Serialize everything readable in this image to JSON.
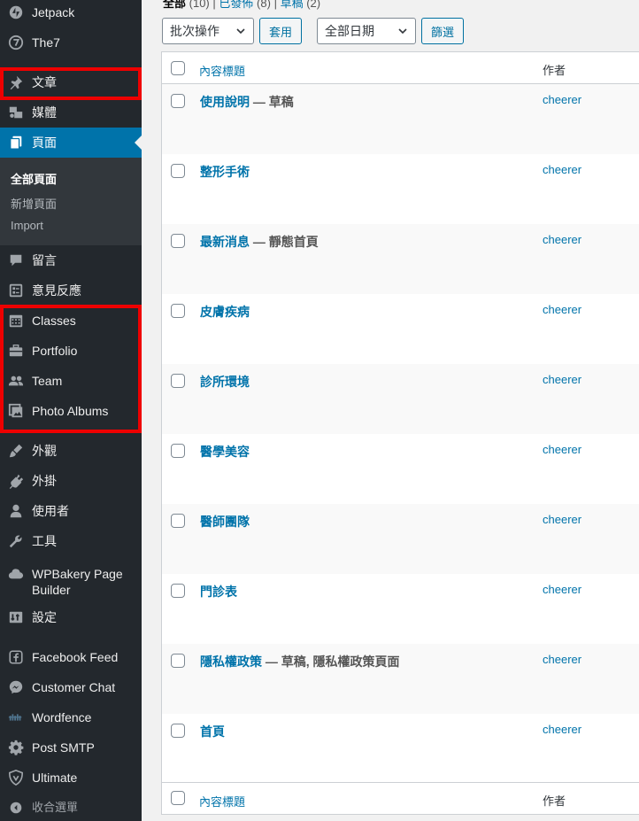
{
  "sidebar": {
    "items": [
      {
        "key": "jetpack",
        "label": "Jetpack",
        "icon": "jetpack-icon"
      },
      {
        "key": "the7",
        "label": "The7",
        "icon": "the7-icon"
      },
      {
        "key": "posts",
        "label": "文章",
        "icon": "pin-icon"
      },
      {
        "key": "media",
        "label": "媒體",
        "icon": "media-icon"
      },
      {
        "key": "pages",
        "label": "頁面",
        "icon": "pages-icon"
      },
      {
        "key": "comments",
        "label": "留言",
        "icon": "comment-icon"
      },
      {
        "key": "feedback",
        "label": "意見反應",
        "icon": "feedback-icon"
      },
      {
        "key": "classes",
        "label": "Classes",
        "icon": "calendar-icon"
      },
      {
        "key": "portfolio",
        "label": "Portfolio",
        "icon": "briefcase-icon"
      },
      {
        "key": "team",
        "label": "Team",
        "icon": "team-icon"
      },
      {
        "key": "albums",
        "label": "Photo Albums",
        "icon": "gallery-icon"
      },
      {
        "key": "appearance",
        "label": "外觀",
        "icon": "brush-icon"
      },
      {
        "key": "plugins",
        "label": "外掛",
        "icon": "plugin-icon"
      },
      {
        "key": "users",
        "label": "使用者",
        "icon": "user-icon"
      },
      {
        "key": "tools",
        "label": "工具",
        "icon": "wrench-icon"
      },
      {
        "key": "wpbakery",
        "label": "WPBakery Page Builder",
        "icon": "cloud-icon"
      },
      {
        "key": "settings",
        "label": "設定",
        "icon": "settings-icon"
      },
      {
        "key": "facebook",
        "label": "Facebook Feed",
        "icon": "facebook-icon"
      },
      {
        "key": "chat",
        "label": "Customer Chat",
        "icon": "messenger-icon"
      },
      {
        "key": "wordfence",
        "label": "Wordfence",
        "icon": "wordfence-icon"
      },
      {
        "key": "smtp",
        "label": "Post SMTP",
        "icon": "gear-icon"
      },
      {
        "key": "ultimate",
        "label": "Ultimate",
        "icon": "shield-icon"
      },
      {
        "key": "collapse",
        "label": "收合選單",
        "icon": "collapse-icon"
      }
    ],
    "submenu": [
      "全部頁面",
      "新增頁面",
      "Import"
    ]
  },
  "views": {
    "all": "全部",
    "all_count": "(10)",
    "published": "已發佈",
    "published_count": "(8)",
    "drafts": "草稿",
    "drafts_count": "(2)",
    "sep": "|"
  },
  "toolbar": {
    "bulk_action": "批次操作",
    "apply": "套用",
    "date_filter": "全部日期",
    "filter": "篩選"
  },
  "table": {
    "col_title": "內容標題",
    "col_author": "作者",
    "rows": [
      {
        "title": "使用說明",
        "state": " — 草稿",
        "author": "cheerer"
      },
      {
        "title": "整形手術",
        "state": "",
        "author": "cheerer"
      },
      {
        "title": "最新消息",
        "state": " — 靜態首頁",
        "author": "cheerer"
      },
      {
        "title": "皮膚疾病",
        "state": "",
        "author": "cheerer"
      },
      {
        "title": "診所環境",
        "state": "",
        "author": "cheerer"
      },
      {
        "title": "醫學美容",
        "state": "",
        "author": "cheerer"
      },
      {
        "title": "醫師團隊",
        "state": "",
        "author": "cheerer"
      },
      {
        "title": "門診表",
        "state": "",
        "author": "cheerer"
      },
      {
        "title": "隱私權政策",
        "state": " — 草稿, 隱私權政策頁面",
        "author": "cheerer"
      },
      {
        "title": "首頁",
        "state": "",
        "author": "cheerer"
      }
    ]
  },
  "colors": {
    "sidebar_bg": "#23282d",
    "active": "#0073aa",
    "highlight_box": "#e00000",
    "link": "#0073aa"
  }
}
